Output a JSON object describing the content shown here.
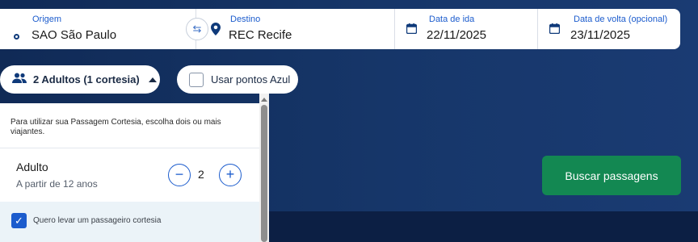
{
  "searchbar": {
    "origin": {
      "label": "Origem",
      "value": "SAO São Paulo"
    },
    "destination": {
      "label": "Destino",
      "value": "REC Recife"
    },
    "depart": {
      "label": "Data de ida",
      "value": "22/11/2025"
    },
    "return": {
      "label": "Data de volta (opcional)",
      "value": "23/11/2025"
    }
  },
  "passengers_pill": {
    "label": "2 Adultos (1 cortesia)"
  },
  "points_pill": {
    "label": "Usar pontos Azul",
    "checked": false
  },
  "panel": {
    "info": "Para utilizar sua Passagem Cortesia, escolha dois ou mais viajantes.",
    "adult": {
      "title": "Adulto",
      "subtitle": "A partir de 12 anos",
      "count": "2"
    },
    "cortesia": {
      "label": "Quero levar um passageiro cortesia",
      "checked": true
    }
  },
  "search_button": {
    "label": "Buscar passagens"
  },
  "colors": {
    "accent": "#1c5ccd",
    "hero_dark": "#102a56",
    "cta_green": "#138852"
  },
  "icons": [
    "origin-dot-icon",
    "swap-icon",
    "location-pin-icon",
    "calendar-icon",
    "people-icon",
    "caret-up-icon",
    "minus-icon",
    "plus-icon",
    "checkmark-icon"
  ]
}
